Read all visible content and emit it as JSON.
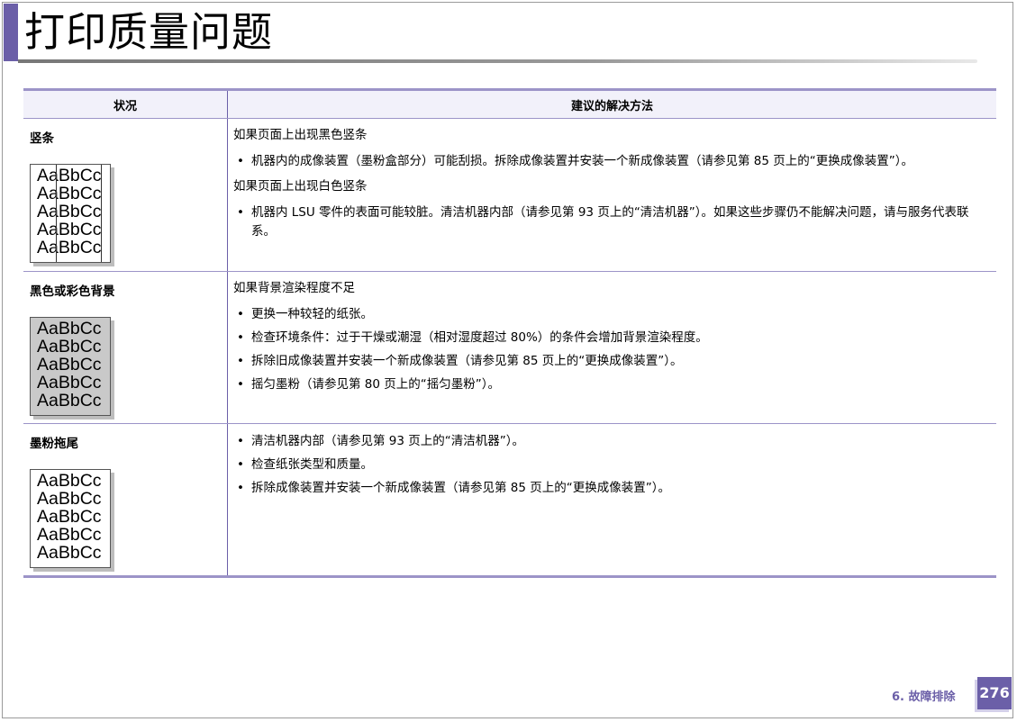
{
  "title": "打印质量问题",
  "table": {
    "headers": {
      "condition": "状况",
      "solution": "建议的解决方法"
    },
    "rows": [
      {
        "condition": "竖条",
        "sample_lines": [
          "AaBbCc",
          "AaBbCc",
          "AaBbCc",
          "AaBbCc",
          "AaBbCc"
        ],
        "solution_blocks": [
          {
            "intro": "如果页面上出现黑色竖条",
            "bullets": [
              "机器内的成像装置（墨粉盒部分）可能刮损。拆除成像装置并安装一个新成像装置（请参见第 85 页上的“更换成像装置”）。"
            ]
          },
          {
            "intro": "如果页面上出现白色竖条",
            "bullets": [
              "机器内 LSU 零件的表面可能较脏。清洁机器内部（请参见第 93 页上的“清洁机器”）。如果这些步骤仍不能解决问题，请与服务代表联系。"
            ]
          }
        ]
      },
      {
        "condition": "黑色或彩色背景",
        "sample_lines": [
          "AaBbCc",
          "AaBbCc",
          "AaBbCc",
          "AaBbCc",
          "AaBbCc"
        ],
        "solution_blocks": [
          {
            "intro": "如果背景渲染程度不足",
            "bullets": [
              "更换一种较轻的纸张。",
              "检查环境条件：过于干燥或潮湿（相对湿度超过 80%）的条件会增加背景渲染程度。",
              "拆除旧成像装置并安装一个新成像装置（请参见第 85 页上的“更换成像装置”）。",
              "摇匀墨粉（请参见第 80 页上的“摇匀墨粉”）。"
            ]
          }
        ]
      },
      {
        "condition": "墨粉拖尾",
        "sample_lines": [
          "AaBbCc",
          "AaBbCc",
          "AaBbCc",
          "AaBbCc",
          "AaBbCc"
        ],
        "solution_blocks": [
          {
            "intro": "",
            "bullets": [
              "清洁机器内部（请参见第 93 页上的“清洁机器”）。",
              "检查纸张类型和质量。",
              "拆除成像装置并安装一个新成像装置（请参见第 85 页上的“更换成像装置”）。"
            ]
          }
        ]
      }
    ]
  },
  "footer": {
    "chapter": "6.  故障排除",
    "page_number": "276"
  },
  "colors": {
    "accent": "#6b5fa8",
    "table_rule": "#9c94c8",
    "header_bg": "#f2f1fa"
  }
}
